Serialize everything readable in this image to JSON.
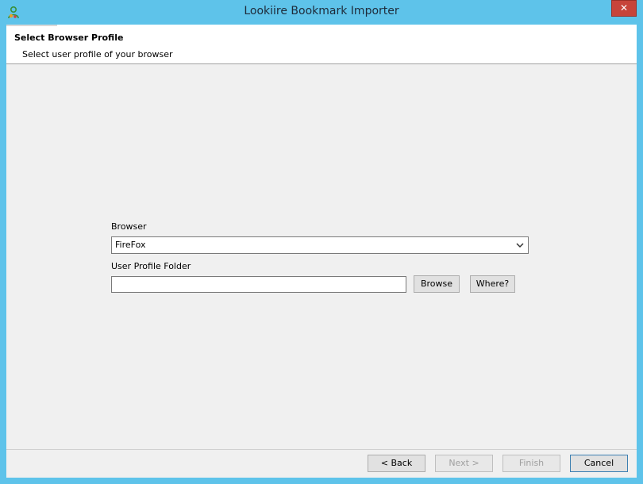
{
  "window": {
    "title": "Lookiire Bookmark Importer",
    "close_glyph": "✕",
    "app_icon": "user-profile-icon"
  },
  "header": {
    "title": "Select Browser Profile",
    "subtitle": "Select user profile of your browser"
  },
  "form": {
    "browser_label": "Browser",
    "browser_value": "FireFox",
    "profile_label": "User Profile Folder",
    "profile_value": "",
    "browse_label": "Browse",
    "where_label": "Where?"
  },
  "footer": {
    "back_label": "< Back",
    "next_label": "Next >",
    "finish_label": "Finish",
    "cancel_label": "Cancel"
  },
  "colors": {
    "title_bar": "#5ec3ea",
    "close_button": "#c7443a",
    "client_bg": "#f0f0f0"
  }
}
